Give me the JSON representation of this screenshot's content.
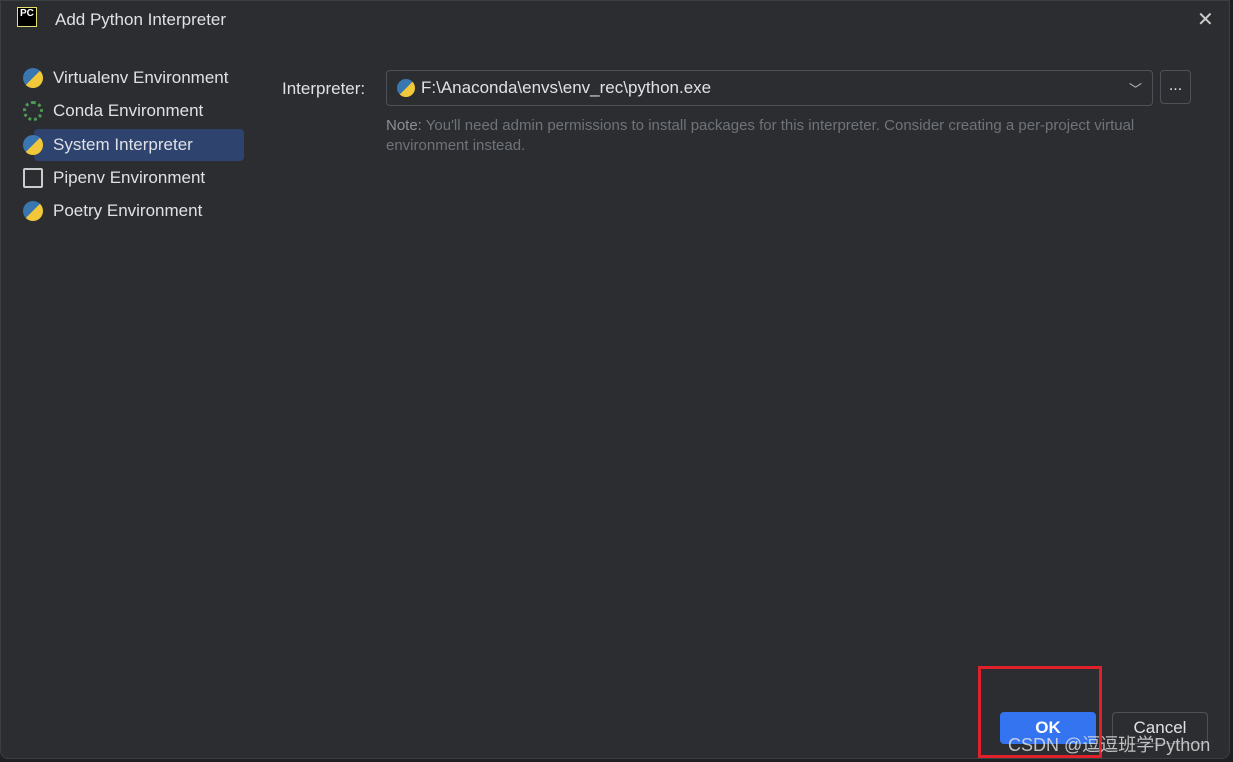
{
  "dialog": {
    "title": "Add Python Interpreter",
    "logo": "PC"
  },
  "sidebar": {
    "items": [
      {
        "label": "Virtualenv Environment",
        "icon": "python-virtualenv-icon"
      },
      {
        "label": "Conda Environment",
        "icon": "conda-icon"
      },
      {
        "label": "System Interpreter",
        "icon": "python-icon",
        "selected": true
      },
      {
        "label": "Pipenv Environment",
        "icon": "pipenv-folder-icon"
      },
      {
        "label": "Poetry Environment",
        "icon": "poetry-icon"
      }
    ]
  },
  "main": {
    "interpreter_label": "Interpreter:",
    "interpreter_value": "F:\\Anaconda\\envs\\env_rec\\python.exe",
    "browse_label": "...",
    "note_prefix": "Note:",
    "note_text": " You'll need admin permissions to install packages for this interpreter. Consider creating a per-project virtual environment instead."
  },
  "buttons": {
    "ok": "OK",
    "cancel": "Cancel"
  },
  "watermark": "CSDN @逗逗班学Python"
}
